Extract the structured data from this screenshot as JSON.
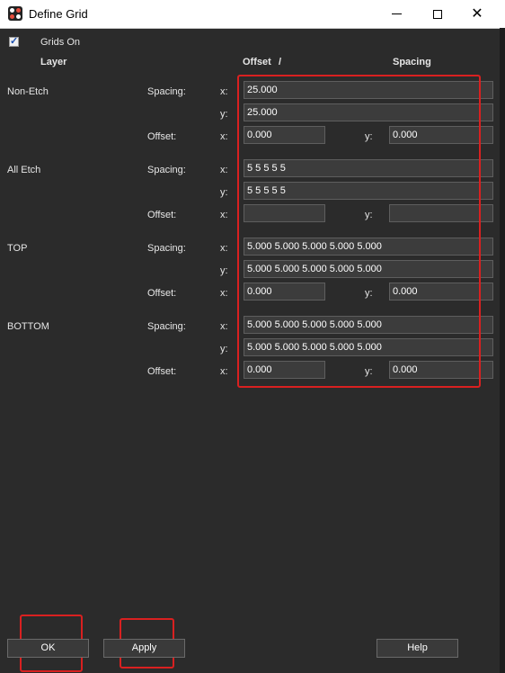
{
  "window": {
    "title": "Define Grid"
  },
  "grids_on": {
    "label": "Grids On",
    "checked": true
  },
  "headers": {
    "layer": "Layer",
    "offset": "Offset",
    "slash": "/",
    "spacing": "Spacing"
  },
  "field_labels": {
    "spacing": "Spacing:",
    "offset": "Offset:",
    "x": "x:",
    "y": "y:"
  },
  "layers": [
    {
      "name": "Non-Etch",
      "spacing_x": "25.000",
      "spacing_y": "25.000",
      "offset_x": "0.000",
      "offset_y": "0.000"
    },
    {
      "name": "All Etch",
      "spacing_x": "5 5 5 5 5",
      "spacing_y": "5 5 5 5 5",
      "offset_x": "",
      "offset_y": ""
    },
    {
      "name": "TOP",
      "spacing_x": "5.000 5.000 5.000 5.000 5.000",
      "spacing_y": "5.000 5.000 5.000 5.000 5.000",
      "offset_x": "0.000",
      "offset_y": "0.000"
    },
    {
      "name": "BOTTOM",
      "spacing_x": "5.000 5.000 5.000 5.000 5.000",
      "spacing_y": "5.000 5.000 5.000 5.000 5.000",
      "offset_x": "0.000",
      "offset_y": "0.000"
    }
  ],
  "buttons": {
    "ok": "OK",
    "apply": "Apply",
    "help": "Help"
  },
  "colors": {
    "background": "#2b2b2b",
    "highlight": "#d92020",
    "field_bg": "#3c3c3c"
  }
}
